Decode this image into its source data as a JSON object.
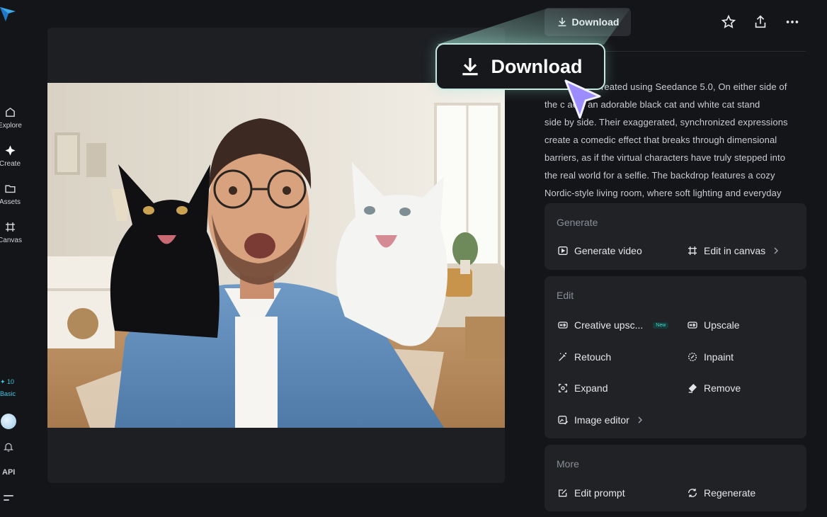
{
  "sidebar": {
    "items": [
      {
        "label": "Explore",
        "icon": "home-icon"
      },
      {
        "label": "Create",
        "icon": "sparkle-icon"
      },
      {
        "label": "Assets",
        "icon": "folder-icon"
      },
      {
        "label": "Canvas",
        "icon": "crop-icon"
      }
    ],
    "credits_count": "✦ 10",
    "plan": "Basic",
    "api_label": "API"
  },
  "header": {
    "download_label": "Download",
    "icons": [
      "star-icon",
      "share-icon",
      "more-icon"
    ]
  },
  "callout": {
    "download_label": "Download"
  },
  "description": {
    "lines": [
      "reated using Seedance 5.0, On either side of",
      "the c          ace, an adorable black cat and white cat stand",
      "side by side. Their exaggerated, synchronized expressions",
      "create a comedic effect that breaks through dimensional",
      "barriers, as if the virtual characters have truly stepped into",
      "the real world for a selfie. The backdrop features a cozy",
      "Nordic-style living room, where soft lighting and everyday"
    ]
  },
  "generate": {
    "title": "Generate",
    "generate_video": "Generate video",
    "edit_in_canvas": "Edit in canvas"
  },
  "edit": {
    "title": "Edit",
    "creative_upscale": "Creative upsc...",
    "new_badge": "New",
    "upscale": "Upscale",
    "retouch": "Retouch",
    "inpaint": "Inpaint",
    "expand": "Expand",
    "remove": "Remove",
    "image_editor": "Image editor"
  },
  "more": {
    "title": "More",
    "edit_prompt": "Edit prompt",
    "regenerate": "Regenerate"
  },
  "colors": {
    "background": "#141518",
    "card": "#202226",
    "accent_cyan": "#3ec7e0",
    "cursor_purple": "#9b8cff"
  }
}
